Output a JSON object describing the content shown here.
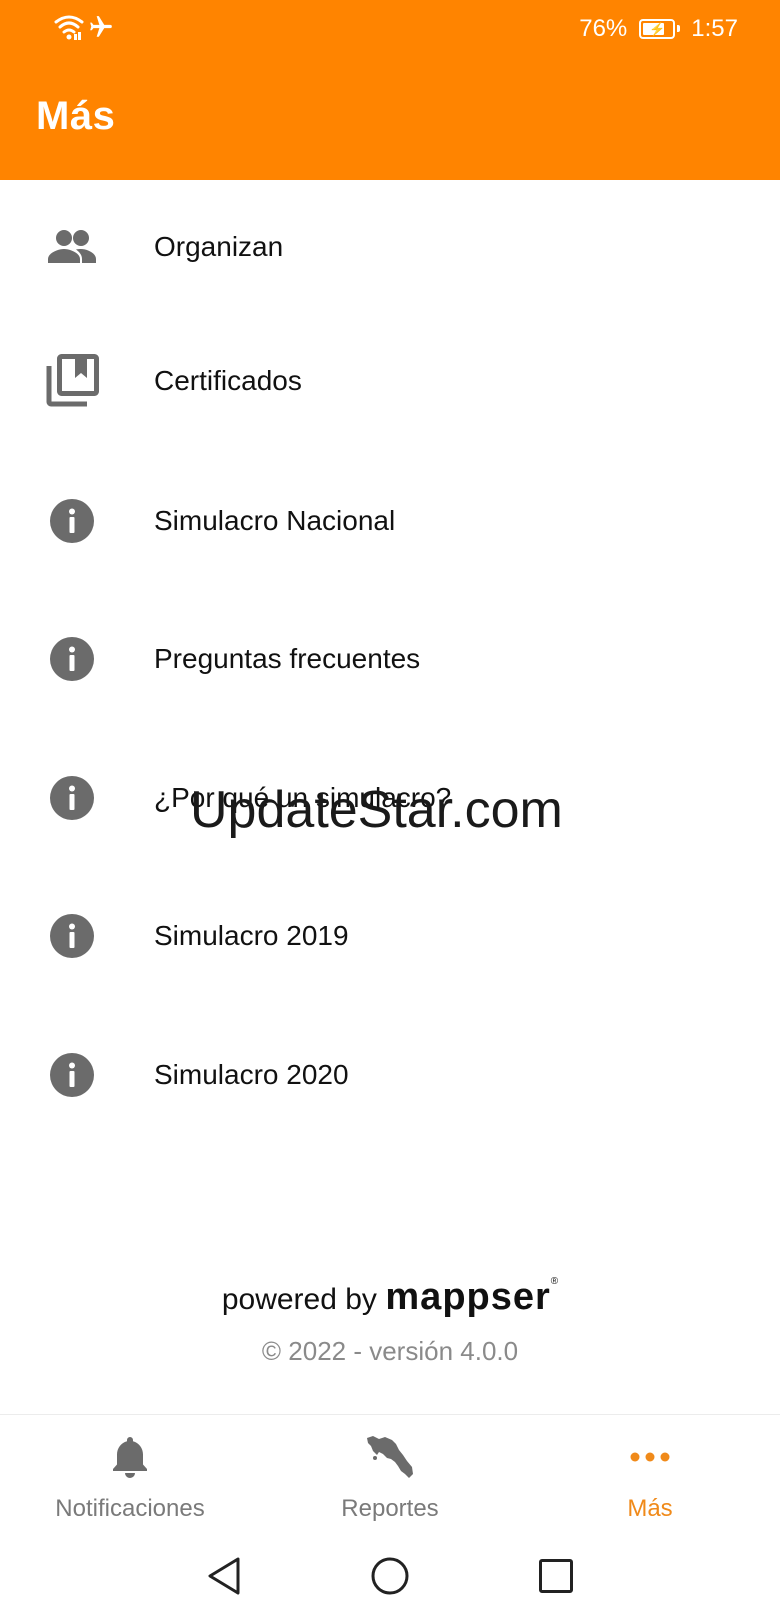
{
  "status_bar": {
    "battery_percent_text": "76%",
    "battery_level": 0.76,
    "time": "1:57",
    "icons": [
      "wifi-icon",
      "airplane-mode-icon",
      "battery-charging-icon"
    ]
  },
  "header": {
    "title": "Más",
    "background_color": "#ff8400"
  },
  "menu": {
    "items": [
      {
        "label": "Organizan",
        "icon": "people-icon"
      },
      {
        "label": "Certificados",
        "icon": "bookmarks-icon"
      },
      {
        "label": "Simulacro Nacional",
        "icon": "info-icon"
      },
      {
        "label": "Preguntas frecuentes",
        "icon": "info-icon"
      },
      {
        "label": "¿Por qué un simulacro?",
        "icon": "info-icon"
      },
      {
        "label": "Simulacro 2019",
        "icon": "info-icon"
      },
      {
        "label": "Simulacro 2020",
        "icon": "info-icon"
      }
    ]
  },
  "watermark": "UpdateStar.com",
  "footer": {
    "powered_by": "powered by",
    "brand": "mappser",
    "brand_mark": "®",
    "version": "© 2022 - versión 4.0.0"
  },
  "bottom_nav": {
    "tabs": [
      {
        "label": "Notificaciones",
        "icon": "bell-icon",
        "active": false
      },
      {
        "label": "Reportes",
        "icon": "costa-rica-map-icon",
        "active": false
      },
      {
        "label": "Más",
        "icon": "more-dots-icon",
        "active": true
      }
    ],
    "active_color": "#f08a1a",
    "inactive_color": "#7a7a7a"
  },
  "system_nav": {
    "buttons": [
      "back-icon",
      "home-icon",
      "recents-icon"
    ]
  }
}
